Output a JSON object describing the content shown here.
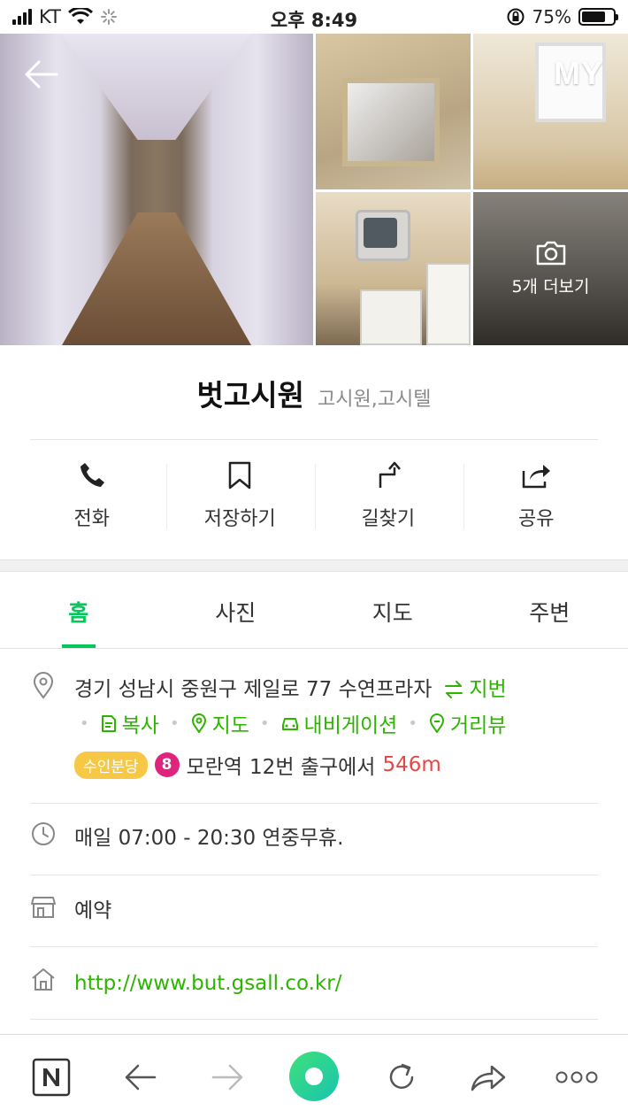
{
  "status": {
    "carrier": "KT",
    "time": "오후 8:49",
    "battery": "75%",
    "battery_level": 0.75
  },
  "header": {
    "my_label": "MY",
    "more_photos": "5개 더보기"
  },
  "place": {
    "name": "벗고시원",
    "category": "고시원,고시텔"
  },
  "actions": [
    {
      "label": "전화",
      "icon": "phone-icon"
    },
    {
      "label": "저장하기",
      "icon": "bookmark-icon"
    },
    {
      "label": "길찾기",
      "icon": "directions-icon"
    },
    {
      "label": "공유",
      "icon": "share-icon"
    }
  ],
  "tabs": [
    {
      "label": "홈",
      "active": true
    },
    {
      "label": "사진",
      "active": false
    },
    {
      "label": "지도",
      "active": false
    },
    {
      "label": "주변",
      "active": false
    }
  ],
  "address": {
    "text": "경기 성남시 중원구 제일로 77 수연프라자",
    "jibun": "지번",
    "links": [
      "복사",
      "지도",
      "내비게이션",
      "거리뷰"
    ]
  },
  "subway": {
    "line_name": "수인분당",
    "line_number": "8",
    "station": "모란역",
    "exit_text": "12번 출구에서",
    "distance": "546m"
  },
  "hours": "매일 07:00 - 20:30 연중무휴.",
  "reservation": "예약",
  "website": "http://www.but.gsall.co.kr/",
  "colors": {
    "accent": "#03c75a",
    "link_green": "#2db400",
    "distance_red": "#e54646",
    "line_badge": "#f7c846",
    "line_8": "#e0237c"
  }
}
